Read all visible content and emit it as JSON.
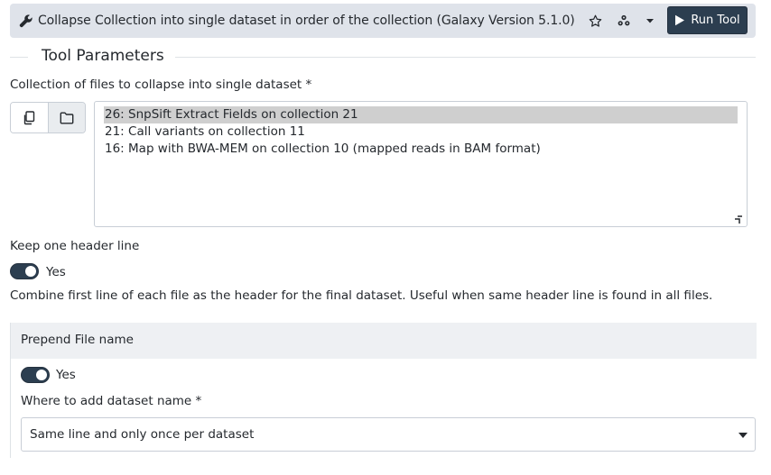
{
  "header": {
    "title": "Collapse Collection into single dataset in order of the collection (Galaxy Version 5.1.0)",
    "run_label": "Run Tool",
    "icons": [
      "wrench-icon",
      "star-icon",
      "share-icon",
      "caret-down-icon",
      "play-icon"
    ]
  },
  "section": {
    "title": "Tool Parameters"
  },
  "collection": {
    "label": "Collection of files to collapse into single dataset *",
    "options": [
      "26: SnpSift Extract Fields on collection 21",
      "21: Call variants on collection 11",
      "16: Map with BWA-MEM on collection 10 (mapped reads in BAM format)"
    ],
    "selected_index": 0
  },
  "keep_header": {
    "label": "Keep one header line",
    "toggle_label": "Yes",
    "checked": true,
    "help": "Combine first line of each file as the header for the final dataset. Useful when same header line is found in all files."
  },
  "prepend": {
    "title": "Prepend File name",
    "toggle_label": "Yes",
    "checked": true,
    "where_label": "Where to add dataset name *",
    "where_value": "Same line and only once per dataset"
  },
  "colors": {
    "accent": "#2c3e50",
    "header_bg": "#dfe3ea",
    "panel_bg": "#eef0f3",
    "selected_bg": "#cfcfcf"
  }
}
